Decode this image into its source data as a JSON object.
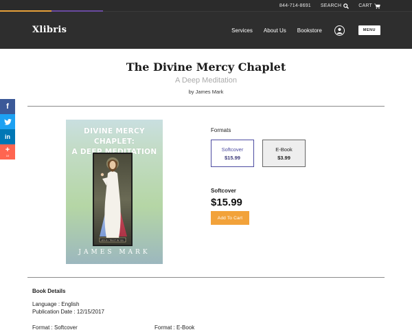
{
  "topbar": {
    "phone": "844-714-8691",
    "search_label": "SEARCH",
    "cart_label": "CART"
  },
  "header": {
    "logo": "Xlibris",
    "nav": [
      "Services",
      "About Us",
      "Bookstore"
    ],
    "menu_label": "MENU"
  },
  "social": {
    "facebook": "f",
    "linkedin": "in",
    "share": "+",
    "share_count": "10"
  },
  "book": {
    "title": "The Divine Mercy Chaplet",
    "subtitle": "A Deep Meditation",
    "byline": "by James Mark",
    "cover_title_line1": "DIVINE MERCY CHAPLET:",
    "cover_title_line2": "A DEEP MEDITATION",
    "cover_author": "JAMES MARK",
    "cover_banner_text": "JESUS I TRUST IN YOU"
  },
  "formats": {
    "label": "Formats",
    "options": [
      {
        "name": "Softcover",
        "price": "$15.99"
      },
      {
        "name": "E-Book",
        "price": "$3.99"
      }
    ],
    "selected_name": "Softcover",
    "selected_price": "$15.99",
    "add_to_cart": "Add To Cart"
  },
  "details": {
    "heading": "Book Details",
    "language": "Language : English",
    "publication_date": "Publication Date : 12/15/2017",
    "format_left": "Format : Softcover",
    "format_right": "Format : E-Book"
  },
  "colors": {
    "header_bg": "#2e2e2e",
    "accent_orange": "#f2a23a",
    "accent_purple": "#4b4aa0"
  }
}
